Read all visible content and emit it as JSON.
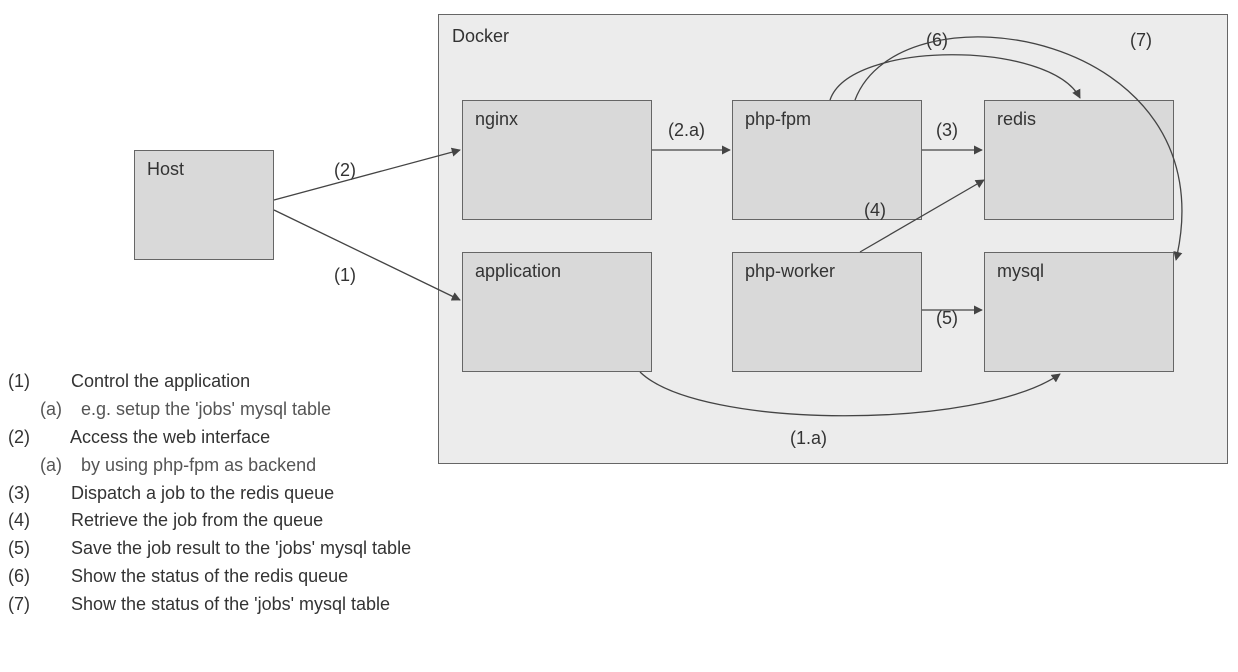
{
  "container": {
    "label": "Docker"
  },
  "nodes": {
    "host": "Host",
    "nginx": "nginx",
    "phpfpm": "php-fpm",
    "redis": "redis",
    "application": "application",
    "phpworker": "php-worker",
    "mysql": "mysql"
  },
  "edges": {
    "e1": "(1)",
    "e1a": "(1.a)",
    "e2": "(2)",
    "e2a": "(2.a)",
    "e3": "(3)",
    "e4": "(4)",
    "e5": "(5)",
    "e6": "(6)",
    "e7": "(7)"
  },
  "legend": [
    {
      "num": "(1)",
      "text": "Control the application",
      "sub": {
        "num": "(a)",
        "text": "e.g. setup the 'jobs' mysql table"
      }
    },
    {
      "num": "(2)",
      "text": "Access the web interface",
      "sub": {
        "num": "(a)",
        "text": "by using php-fpm as backend"
      }
    },
    {
      "num": "(3)",
      "text": "Dispatch a job to the redis queue"
    },
    {
      "num": "(4)",
      "text": "Retrieve the job from the queue"
    },
    {
      "num": "(5)",
      "text": "Save the job result to the 'jobs' mysql table"
    },
    {
      "num": "(6)",
      "text": "Show the status of the redis queue"
    },
    {
      "num": "(7)",
      "text": "Show the status of the 'jobs' mysql table"
    }
  ]
}
